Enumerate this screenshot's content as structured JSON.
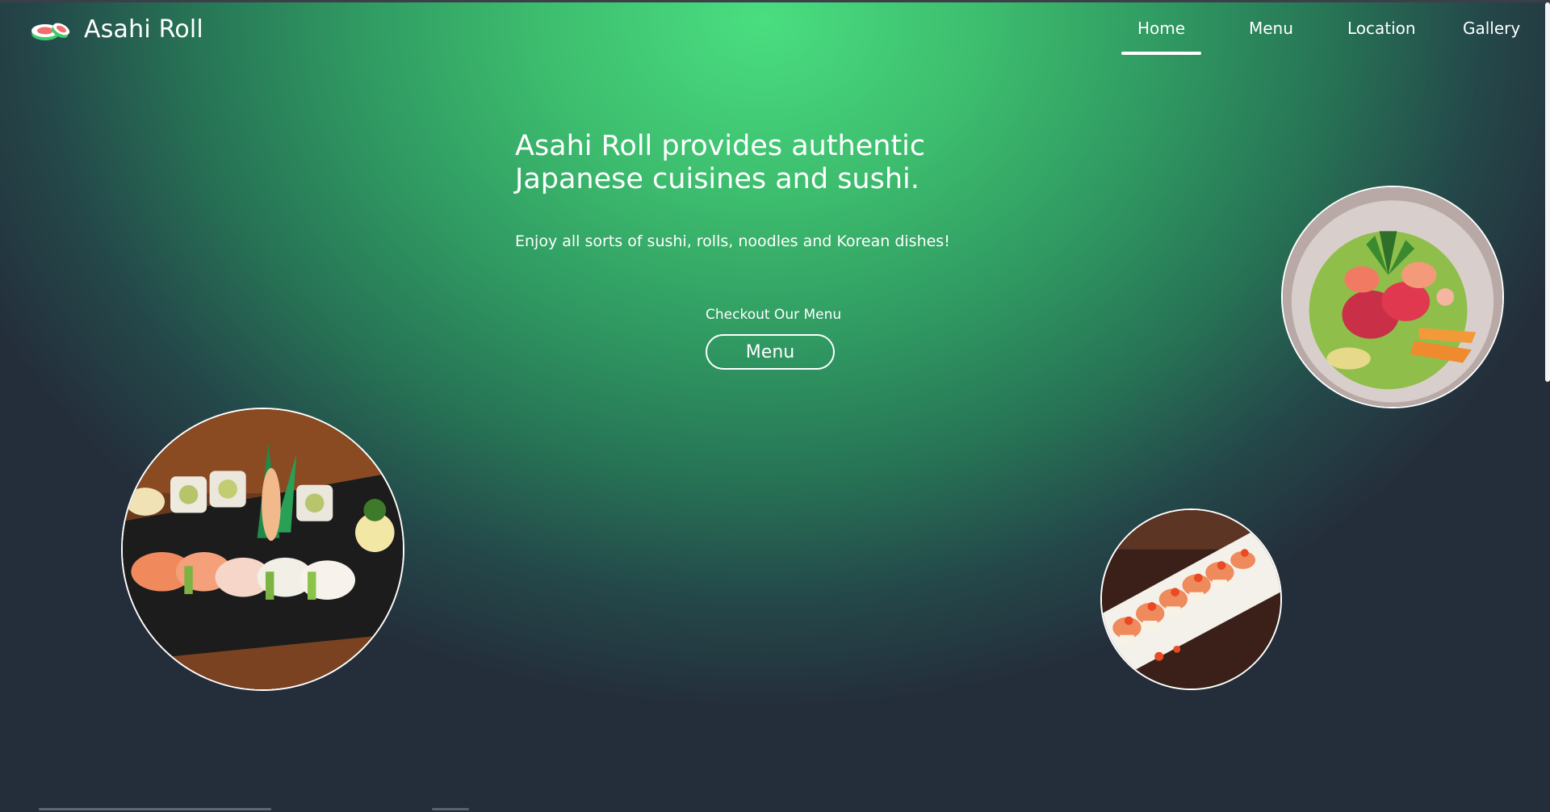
{
  "brand": {
    "name": "Asahi Roll",
    "logo_icon": "sushi-icon"
  },
  "nav": {
    "items": [
      {
        "label": "Home",
        "active": true
      },
      {
        "label": "Menu",
        "active": false
      },
      {
        "label": "Location",
        "active": false
      },
      {
        "label": "Gallery",
        "active": false
      }
    ]
  },
  "hero": {
    "title_line1": "Asahi Roll provides authentic",
    "title_line2": "Japanese cuisines and sushi.",
    "subtitle": "Enjoy all sorts of sushi, rolls, noodles and Korean dishes!",
    "cta_label": "Checkout Our Menu",
    "cta_button": "Menu"
  },
  "colors": {
    "accent": "#4ade80",
    "background": "#242d3a",
    "text": "#ffffff"
  }
}
